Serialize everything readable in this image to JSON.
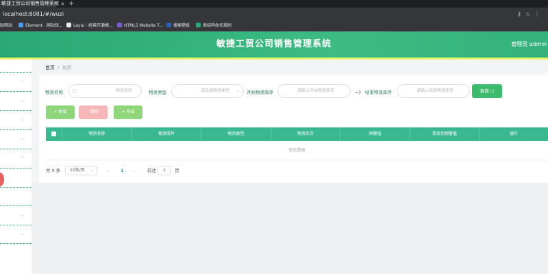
{
  "browser": {
    "tab_title": "敏捷工贸公司销售管理系统",
    "tab_close": "×",
    "new_tab": "+",
    "url": "localhost:8081/#/wuzi",
    "bookmarks": [
      {
        "label": "际网站",
        "color": "#4a90d9"
      },
      {
        "label": "Element - 网站快...",
        "color": "#409eff"
      },
      {
        "label": "Layui - 经典开源模...",
        "color": "#e8eaed"
      },
      {
        "label": "HTML5 Website T...",
        "color": "#7c5cd6"
      },
      {
        "label": "搜索壁纸",
        "color": "#2e5fb8"
      },
      {
        "label": "表结构命名规则",
        "color": "#2aa876"
      }
    ]
  },
  "header": {
    "title": "敏捷工贸公司销售管理系统",
    "user": "管理员 admin"
  },
  "breadcrumb": {
    "home": "首页",
    "sep": "/",
    "current": "物资"
  },
  "filters": {
    "name_label": "物资名称",
    "name_placeholder": "物资名称",
    "type_label": "物资类型",
    "type_placeholder": "请选择物资类型",
    "stock_start_label": "开始物资库存",
    "stock_start_placeholder": "请输入开始物资库存",
    "range_sep": "=》",
    "stock_end_label": "结束物资库存",
    "stock_end_placeholder": "请输入结束物资库存",
    "search_button": "查询 ○"
  },
  "actions": {
    "add": "+ 新增",
    "delete": "- 删除",
    "export": "+ 导出"
  },
  "table": {
    "columns": [
      "物资名称",
      "物资照片",
      "物资类型",
      "物资库存",
      "预警值",
      "是否到预警值",
      "操作"
    ],
    "empty_text": "暂无数据"
  },
  "pager": {
    "total": "共 0 条",
    "page_size": "10条/页",
    "prev": "‹",
    "current": "1",
    "next": "›",
    "goto": "前往",
    "goto_value": "1",
    "page_unit": "页"
  },
  "colors": {
    "brand": "#2aa876",
    "accent_strip": "#e8f56c",
    "danger": "#f7b7b7"
  }
}
